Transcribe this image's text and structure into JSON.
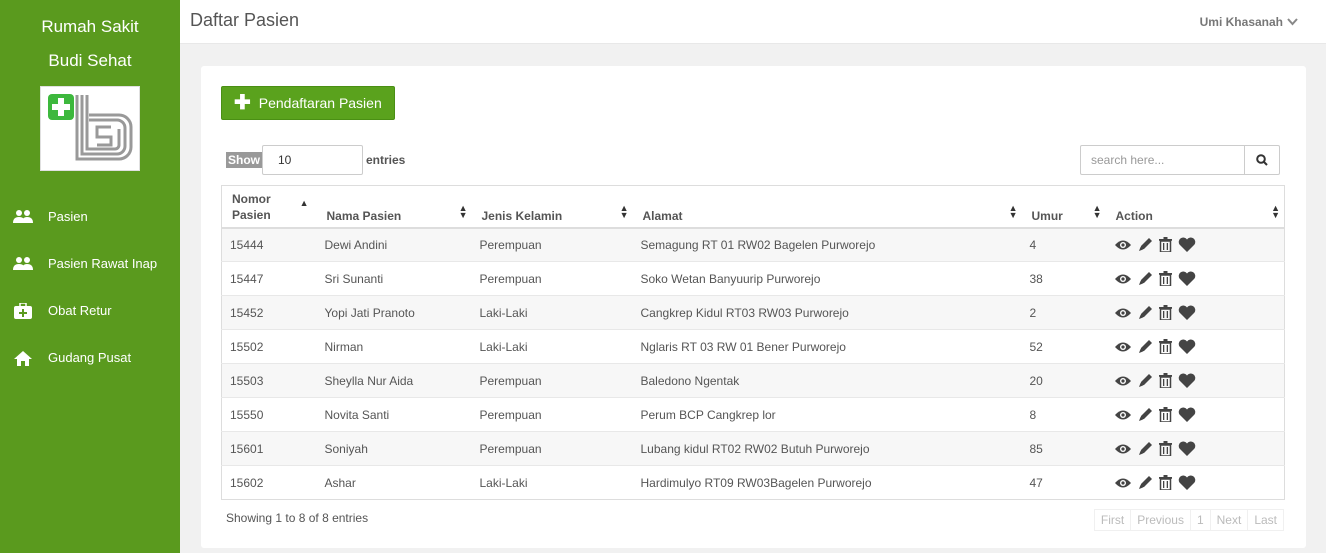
{
  "sidebar": {
    "brand_line1": "Rumah Sakit",
    "brand_line2": "Budi Sehat",
    "items": [
      {
        "label": "Pasien",
        "icon": "users-icon"
      },
      {
        "label": "Pasien Rawat Inap",
        "icon": "users-icon"
      },
      {
        "label": "Obat Retur",
        "icon": "medkit-icon"
      },
      {
        "label": "Gudang Pusat",
        "icon": "home-icon"
      }
    ]
  },
  "header": {
    "title": "Daftar Pasien",
    "user": "Umi Khasanah"
  },
  "toolbar": {
    "add_label": "Pendaftaran Pasien",
    "show_label": "Show",
    "length_value": "10",
    "entries_label": "entries",
    "search_placeholder": "search here..."
  },
  "table": {
    "columns": [
      "Nomor Pasien",
      "Nama Pasien",
      "Jenis Kelamin",
      "Alamat",
      "Umur",
      "Action"
    ],
    "rows": [
      [
        "15444",
        "Dewi Andini",
        "Perempuan",
        "Semagung RT 01 RW02 Bagelen Purworejo",
        "4"
      ],
      [
        "15447",
        "Sri Sunanti",
        "Perempuan",
        "Soko Wetan Banyuurip Purworejo",
        "38"
      ],
      [
        "15452",
        "Yopi Jati Pranoto",
        "Laki-Laki",
        "Cangkrep Kidul RT03 RW03 Purworejo",
        "2"
      ],
      [
        "15502",
        "Nirman",
        "Laki-Laki",
        "Nglaris RT 03 RW 01 Bener Purworejo",
        "52"
      ],
      [
        "15503",
        "Sheylla Nur Aida",
        "Perempuan",
        "Baledono Ngentak",
        "20"
      ],
      [
        "15550",
        "Novita Santi",
        "Perempuan",
        "Perum BCP Cangkrep lor",
        "8"
      ],
      [
        "15601",
        "Soniyah",
        "Perempuan",
        "Lubang kidul RT02 RW02 Butuh Purworejo",
        "85"
      ],
      [
        "15602",
        "Ashar",
        "Laki-Laki",
        "Hardimulyo RT09 RW03Bagelen Purworejo",
        "47"
      ]
    ]
  },
  "footer": {
    "info": "Showing 1 to 8 of 8 entries",
    "pager": [
      "First",
      "Previous",
      "1",
      "Next",
      "Last"
    ]
  },
  "colors": {
    "accent": "#5a9a1e",
    "button": "#5aa21d"
  }
}
